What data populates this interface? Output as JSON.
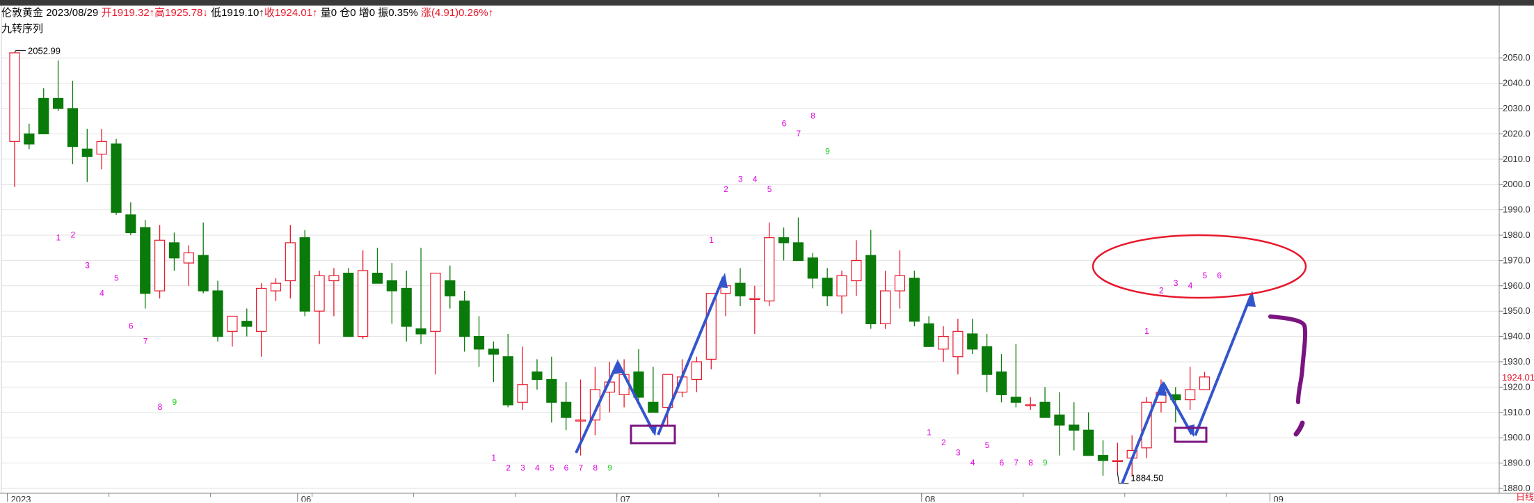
{
  "header": {
    "symbol": "伦敦黄金",
    "date": "2023/08/29",
    "open": "开1919.32↑",
    "high": "高1925.78↓",
    "low": "低1919.10↑",
    "close": "收1924.01↑",
    "volume": "量0",
    "position": "仓0",
    "increase": "增0",
    "amplitude": "振0.35%",
    "change": "涨(4.91)0.26%↑"
  },
  "subtitle": "九转序列",
  "last_price_label": "1924.01",
  "corner_label": "日线",
  "colors": {
    "up": "#e8182c",
    "down": "#0a7a0a",
    "sequence": "#e000e0",
    "sequence_done": "#22cc22",
    "arrow": "#3355cc",
    "ellipse": "#e8182c",
    "box": "#7a1580",
    "grid": "#e2e2e2",
    "axis": "#808080"
  },
  "chart_data": {
    "type": "candlestick",
    "title": "伦敦黄金",
    "ylim": [
      1880,
      2055
    ],
    "y_ticks": [
      "1880.0",
      "1890.0",
      "1900.0",
      "1910.0",
      "1920.0",
      "1930.0",
      "1940.0",
      "1950.0",
      "1960.0",
      "1970.0",
      "1980.0",
      "1990.0",
      "2000.0",
      "2010.0",
      "2020.0",
      "2030.0",
      "2040.0",
      "2050.0"
    ],
    "x_ticks": [
      {
        "label": "2023",
        "index": 0
      },
      {
        "label": "06",
        "index": 20
      },
      {
        "label": "07",
        "index": 42
      },
      {
        "label": "08",
        "index": 63
      },
      {
        "label": "09",
        "index": 87
      }
    ],
    "annotations": {
      "max": {
        "label": "2052.99",
        "index": 0,
        "value": 2052.99
      },
      "min": {
        "label": "1884.50",
        "index": 76,
        "value": 1884.5
      }
    },
    "candles": [
      [
        2017,
        2052,
        1999,
        2052
      ],
      [
        2020,
        2024,
        2014,
        2016
      ],
      [
        2034,
        2038,
        2020,
        2020
      ],
      [
        2034,
        2049,
        2029,
        2030
      ],
      [
        2030,
        2041,
        2008,
        2015
      ],
      [
        2014,
        2022,
        2001,
        2011
      ],
      [
        2012,
        2022,
        2006,
        2017
      ],
      [
        2016,
        2018,
        1988,
        1989
      ],
      [
        1988,
        1993,
        1980,
        1981
      ],
      [
        1983,
        1986,
        1951,
        1957
      ],
      [
        1958,
        1984,
        1955,
        1978
      ],
      [
        1977,
        1981,
        1966,
        1971
      ],
      [
        1969,
        1976,
        1960,
        1973
      ],
      [
        1972,
        1985,
        1957,
        1958
      ],
      [
        1958,
        1962,
        1938,
        1940
      ],
      [
        1942,
        1948,
        1936,
        1948
      ],
      [
        1946,
        1951,
        1940,
        1944
      ],
      [
        1942,
        1961,
        1932,
        1959
      ],
      [
        1958,
        1963,
        1954,
        1961
      ],
      [
        1962,
        1984,
        1955,
        1977
      ],
      [
        1979,
        1982,
        1948,
        1950
      ],
      [
        1950,
        1966,
        1937,
        1964
      ],
      [
        1962,
        1967,
        1948,
        1964
      ],
      [
        1965,
        1967,
        1940,
        1940
      ],
      [
        1940,
        1974,
        1939,
        1966
      ],
      [
        1965,
        1975,
        1962,
        1961
      ],
      [
        1962,
        1969,
        1945,
        1958
      ],
      [
        1959,
        1966,
        1938,
        1944
      ],
      [
        1943,
        1975,
        1937,
        1941
      ],
      [
        1942,
        1963,
        1925,
        1965
      ],
      [
        1962,
        1968,
        1951,
        1956
      ],
      [
        1954,
        1958,
        1934,
        1940
      ],
      [
        1940,
        1948,
        1928,
        1935
      ],
      [
        1935,
        1938,
        1922,
        1933
      ],
      [
        1932,
        1941,
        1912,
        1913
      ],
      [
        1914,
        1936,
        1911,
        1921
      ],
      [
        1926,
        1931,
        1919,
        1923
      ],
      [
        1923,
        1932,
        1906,
        1914
      ],
      [
        1914,
        1922,
        1903,
        1908
      ],
      [
        1907,
        1923,
        1893,
        1907
      ],
      [
        1907,
        1928,
        1901,
        1919
      ],
      [
        1918,
        1930,
        1910,
        1922
      ],
      [
        1917,
        1931,
        1912,
        1925
      ],
      [
        1926,
        1935,
        1913,
        1916
      ],
      [
        1914,
        1928,
        1910,
        1910
      ],
      [
        1912,
        1922,
        1905,
        1925
      ],
      [
        1918,
        1931,
        1916,
        1924
      ],
      [
        1923,
        1932,
        1918,
        1930
      ],
      [
        1931,
        1957,
        1927,
        1957
      ],
      [
        1957,
        1962,
        1948,
        1960
      ],
      [
        1961,
        1967,
        1952,
        1956
      ],
      [
        1955,
        1960,
        1941,
        1955
      ],
      [
        1954,
        1985,
        1952,
        1979
      ],
      [
        1979,
        1983,
        1970,
        1977
      ],
      [
        1977,
        1987,
        1971,
        1970
      ],
      [
        1971,
        1973,
        1959,
        1963
      ],
      [
        1963,
        1967,
        1952,
        1956
      ],
      [
        1956,
        1966,
        1949,
        1964
      ],
      [
        1962,
        1978,
        1956,
        1970
      ],
      [
        1972,
        1982,
        1943,
        1945
      ],
      [
        1945,
        1966,
        1943,
        1958
      ],
      [
        1958,
        1974,
        1951,
        1964
      ],
      [
        1963,
        1966,
        1944,
        1946
      ],
      [
        1945,
        1948,
        1937,
        1936
      ],
      [
        1935,
        1944,
        1930,
        1940
      ],
      [
        1932,
        1947,
        1925,
        1942
      ],
      [
        1941,
        1947,
        1933,
        1935
      ],
      [
        1936,
        1941,
        1918,
        1925
      ],
      [
        1926,
        1933,
        1914,
        1917
      ],
      [
        1916,
        1937,
        1912,
        1914
      ],
      [
        1913,
        1916,
        1911,
        1913
      ],
      [
        1914,
        1920,
        1909,
        1908
      ],
      [
        1909,
        1918,
        1893,
        1905
      ],
      [
        1905,
        1914,
        1895,
        1903
      ],
      [
        1903,
        1910,
        1895,
        1893
      ],
      [
        1893,
        1899,
        1885,
        1891
      ],
      [
        1891,
        1898,
        1886,
        1891
      ],
      [
        1892,
        1901,
        1885,
        1895
      ],
      [
        1896,
        1916,
        1892,
        1914
      ],
      [
        1914,
        1923,
        1910,
        1918
      ],
      [
        1917,
        1920,
        1906,
        1915
      ],
      [
        1915,
        1928,
        1911,
        1919
      ],
      [
        1919,
        1926,
        1919,
        1924
      ]
    ],
    "sequence_marks": [
      {
        "label": "1",
        "index": 3,
        "value": 1978
      },
      {
        "label": "2",
        "index": 4,
        "value": 1979
      },
      {
        "label": "3",
        "index": 5,
        "value": 1967
      },
      {
        "label": "4",
        "index": 6,
        "value": 1956
      },
      {
        "label": "5",
        "index": 7,
        "value": 1962
      },
      {
        "label": "6",
        "index": 8,
        "value": 1943
      },
      {
        "label": "7",
        "index": 9,
        "value": 1937
      },
      {
        "label": "8",
        "index": 10,
        "value": 1911
      },
      {
        "label": "9",
        "index": 11,
        "value": 1913
      },
      {
        "label": "1",
        "index": 33,
        "value": 1891
      },
      {
        "label": "2",
        "index": 34,
        "value": 1887
      },
      {
        "label": "3",
        "index": 35,
        "value": 1887
      },
      {
        "label": "4",
        "index": 36,
        "value": 1887
      },
      {
        "label": "5",
        "index": 37,
        "value": 1887
      },
      {
        "label": "6",
        "index": 38,
        "value": 1887
      },
      {
        "label": "7",
        "index": 39,
        "value": 1887
      },
      {
        "label": "8",
        "index": 40,
        "value": 1887
      },
      {
        "label": "9",
        "index": 41,
        "value": 1887
      },
      {
        "label": "1",
        "index": 48,
        "value": 1977
      },
      {
        "label": "2",
        "index": 49,
        "value": 1997
      },
      {
        "label": "3",
        "index": 50,
        "value": 2001
      },
      {
        "label": "4",
        "index": 51,
        "value": 2001
      },
      {
        "label": "5",
        "index": 52,
        "value": 1997
      },
      {
        "label": "6",
        "index": 53,
        "value": 2023
      },
      {
        "label": "7",
        "index": 54,
        "value": 2019
      },
      {
        "label": "8",
        "index": 55,
        "value": 2026
      },
      {
        "label": "9",
        "index": 56,
        "value": 2012
      },
      {
        "label": "1",
        "index": 63,
        "value": 1901
      },
      {
        "label": "2",
        "index": 64,
        "value": 1897
      },
      {
        "label": "3",
        "index": 65,
        "value": 1893
      },
      {
        "label": "4",
        "index": 66,
        "value": 1889
      },
      {
        "label": "5",
        "index": 67,
        "value": 1896
      },
      {
        "label": "6",
        "index": 68,
        "value": 1889
      },
      {
        "label": "7",
        "index": 69,
        "value": 1889
      },
      {
        "label": "8",
        "index": 70,
        "value": 1889
      },
      {
        "label": "9",
        "index": 71,
        "value": 1889
      },
      {
        "label": "1",
        "index": 78,
        "value": 1941
      },
      {
        "label": "2",
        "index": 79,
        "value": 1957
      },
      {
        "label": "3",
        "index": 80,
        "value": 1960
      },
      {
        "label": "4",
        "index": 81,
        "value": 1959
      },
      {
        "label": "5",
        "index": 82,
        "value": 1963
      },
      {
        "label": "6",
        "index": 83,
        "value": 1963
      }
    ]
  }
}
